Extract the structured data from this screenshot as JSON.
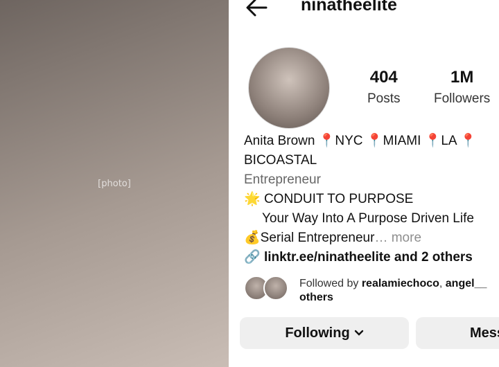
{
  "profile": {
    "username": "ninatheelite",
    "stats": {
      "posts_value": "404",
      "posts_label": "Posts",
      "followers_value": "1M",
      "followers_label": "Followers"
    },
    "bio": {
      "name": "Anita Brown",
      "locations": [
        "NYC",
        "MIAMI",
        "LA"
      ],
      "line2": "BICOASTAL",
      "category": "Entrepreneur",
      "line4": "CONDUIT TO PURPOSE",
      "line5": "Your Way Into A Purpose Driven Life",
      "line6": "Serial Entrepreneur",
      "more": "… more",
      "link": "linktr.ee/ninatheelite and 2 others"
    },
    "followed_by": {
      "prefix": "Followed by ",
      "user1": "realamiechoco",
      "user2": "angel__",
      "suffix": "others"
    },
    "buttons": {
      "following": "Following",
      "message": "Message"
    }
  },
  "icons": {
    "back": "back-arrow-icon",
    "pin": "round-pushpin-icon",
    "star": "glowing-star-icon",
    "moneybag": "money-bag-icon",
    "link": "link-icon",
    "chevron": "chevron-down-icon"
  },
  "colors": {
    "pin": "#e0245e",
    "button_bg": "#efefef",
    "muted": "#666666"
  }
}
